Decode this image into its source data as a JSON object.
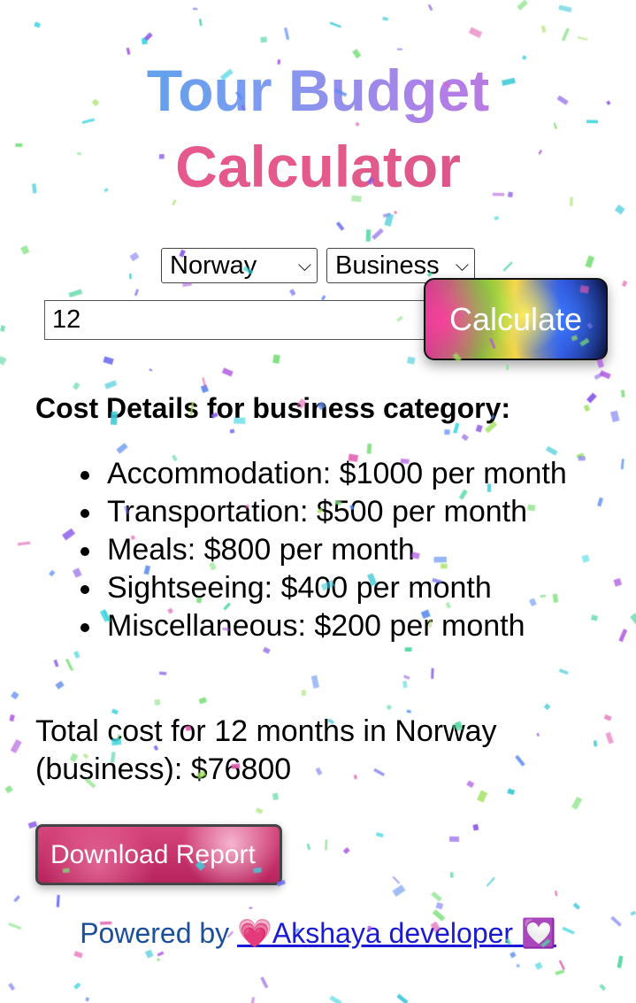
{
  "title": {
    "line1": "Tour Budget",
    "line2": "Calculator"
  },
  "form": {
    "country_selected": "Norway",
    "category_selected": "Business",
    "months_value": "12",
    "calculate_label": "Calculate"
  },
  "result": {
    "heading": "Cost Details for business category:",
    "items": [
      "Accommodation: $1000 per month",
      "Transportation: $500 per month",
      "Meals: $800 per month",
      "Sightseeing: $400 per month",
      "Miscellaneous: $200 per month"
    ],
    "total": "Total cost for 12 months in Norway (business): $76800"
  },
  "download_label": "Download Report",
  "footer": {
    "prefix": "Powered by ",
    "link_text": "💗Akshaya developer 💟"
  },
  "icons": {
    "select_chevron": "chevron-down-icon",
    "list_bullet": "bullet-icon"
  },
  "colors": {
    "title_line1_gradient": [
      "#3fa7e8",
      "#b27ee6"
    ],
    "title_line2": "#e25a8a",
    "download_button": "#c73470",
    "footer_text": "#1b4f9c",
    "footer_link": "#1a1ad6"
  }
}
